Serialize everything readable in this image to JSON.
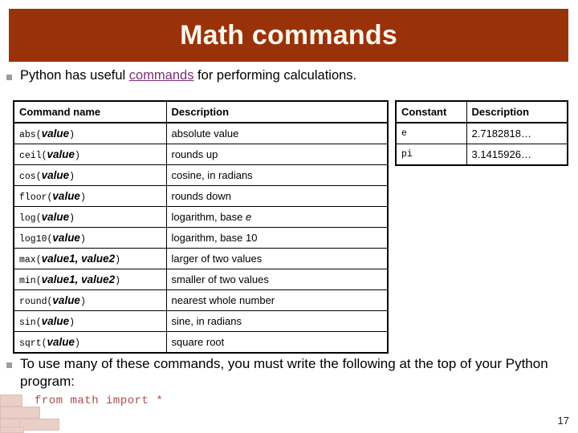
{
  "slide": {
    "title": "Math commands",
    "page_number": "17",
    "banner_color": "#9A3209",
    "title_color": "#FDF6EC",
    "link_color": "#7B2D7B",
    "code_color": "#B14A4A"
  },
  "intro": {
    "before_link": "Python has useful ",
    "link": "commands",
    "after_link": " for performing calculations."
  },
  "commands_table": {
    "headers": [
      "Command name",
      "Description"
    ],
    "rows": [
      {
        "name": "abs(",
        "args": "value",
        "close": ")",
        "description": "absolute value"
      },
      {
        "name": "ceil(",
        "args": "value",
        "close": ")",
        "description": "rounds up"
      },
      {
        "name": "cos(",
        "args": "value",
        "close": ")",
        "description": "cosine, in radians"
      },
      {
        "name": "floor(",
        "args": "value",
        "close": ")",
        "description": "rounds down"
      },
      {
        "name": "log(",
        "args": "value",
        "close": ")",
        "description": "logarithm, base e"
      },
      {
        "name": "log10(",
        "args": "value",
        "close": ")",
        "description": "logarithm, base 10"
      },
      {
        "name": "max(",
        "args": "value1, value2",
        "close": ")",
        "description": "larger of two values"
      },
      {
        "name": "min(",
        "args": "value1, value2",
        "close": ")",
        "description": "smaller of two values"
      },
      {
        "name": "round(",
        "args": "value",
        "close": ")",
        "description": "nearest whole number"
      },
      {
        "name": "sin(",
        "args": "value",
        "close": ")",
        "description": "sine, in radians"
      },
      {
        "name": "sqrt(",
        "args": "value",
        "close": ")",
        "description": "square root"
      }
    ]
  },
  "constants_table": {
    "headers": [
      "Constant",
      "Description"
    ],
    "rows": [
      {
        "constant": "e",
        "description": "2.7182818…"
      },
      {
        "constant": "pi",
        "description": "3.1415926…"
      }
    ]
  },
  "closing": {
    "text": "To use many of these commands, you must write the following at the top of your Python program:",
    "code": "from math import *"
  }
}
